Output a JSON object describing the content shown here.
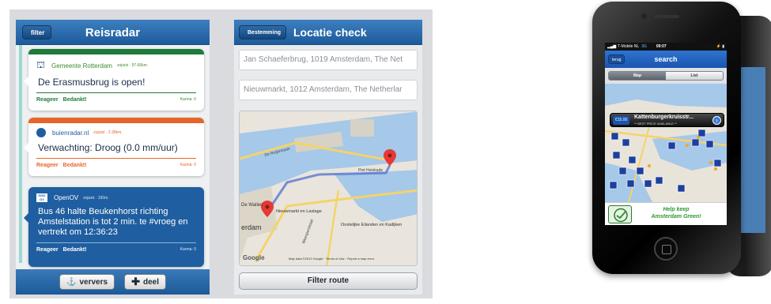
{
  "reisradar": {
    "title": "Reisradar",
    "back_label": "filter",
    "cards": [
      {
        "color": "#1e7b3a",
        "source": "Gemeente Rotterdam",
        "meta": "zojuist · 97.66km.",
        "message": "De Erasmusbrug is open!",
        "reply": "Reageer",
        "thanks": "Bedankt!",
        "karma": "Karma: 0"
      },
      {
        "color": "#e8652a",
        "source": "buienradar.nl",
        "meta": "zojuist · 2.38km.",
        "message": "Verwachting: Droog (0.0 mm/uur)",
        "reply": "Reageer",
        "thanks": "Bedankt!",
        "karma": "Karma: 0"
      },
      {
        "color": "#1f5ea0",
        "source": "OpenOV",
        "meta": "zojuist · 190m.",
        "message": "Bus 46 halte Beukenhorst richting Amstelstation is tot 2 min. te #vroeg en vertrekt om 12:36:23",
        "reply": "Reageer",
        "thanks": "Bedankt!",
        "karma": "Karma: 0"
      }
    ],
    "refresh_label": "ververs",
    "share_label": "deel"
  },
  "locatie": {
    "title": "Locatie check",
    "back_label": "Bestemming",
    "from_value": "Jan Schaeferbrug, 1019 Amsterdam, The Net",
    "to_value": "Nieuwmarkt, 1012 Amsterdam, The Netherlar",
    "map_labels": {
      "de_ruyterkade": "De Ruijterkade",
      "piet_heinkade": "Piet Heinkade",
      "nieuwmarkt": "Nieuwmarkt en Lastage",
      "oostelijke": "Oostelijke Eilanden en Kadijken",
      "weesper": "Weesperstraat",
      "de_wallen": "De Wallen",
      "amsterdam": "erdam",
      "copyright": "Map data ©2013 Google · Terms of Use · Report a map error",
      "google": "Google"
    },
    "filter_label": "Filter route"
  },
  "iphone": {
    "carrier": "T-Mobile NL",
    "network": "3G",
    "time": "09:07",
    "battery": "⚡ ▮",
    "title": "search",
    "back_label": "terug",
    "seg_map": "Map",
    "seg_list": "List",
    "callout_price": "€15.00",
    "callout_title": "Kattenburgerkruisstr...",
    "callout_sub": "** BEST PRICE AVAILABLE **",
    "banner_line1": "Help keep",
    "banner_line2": "Amsterdam Green!"
  }
}
